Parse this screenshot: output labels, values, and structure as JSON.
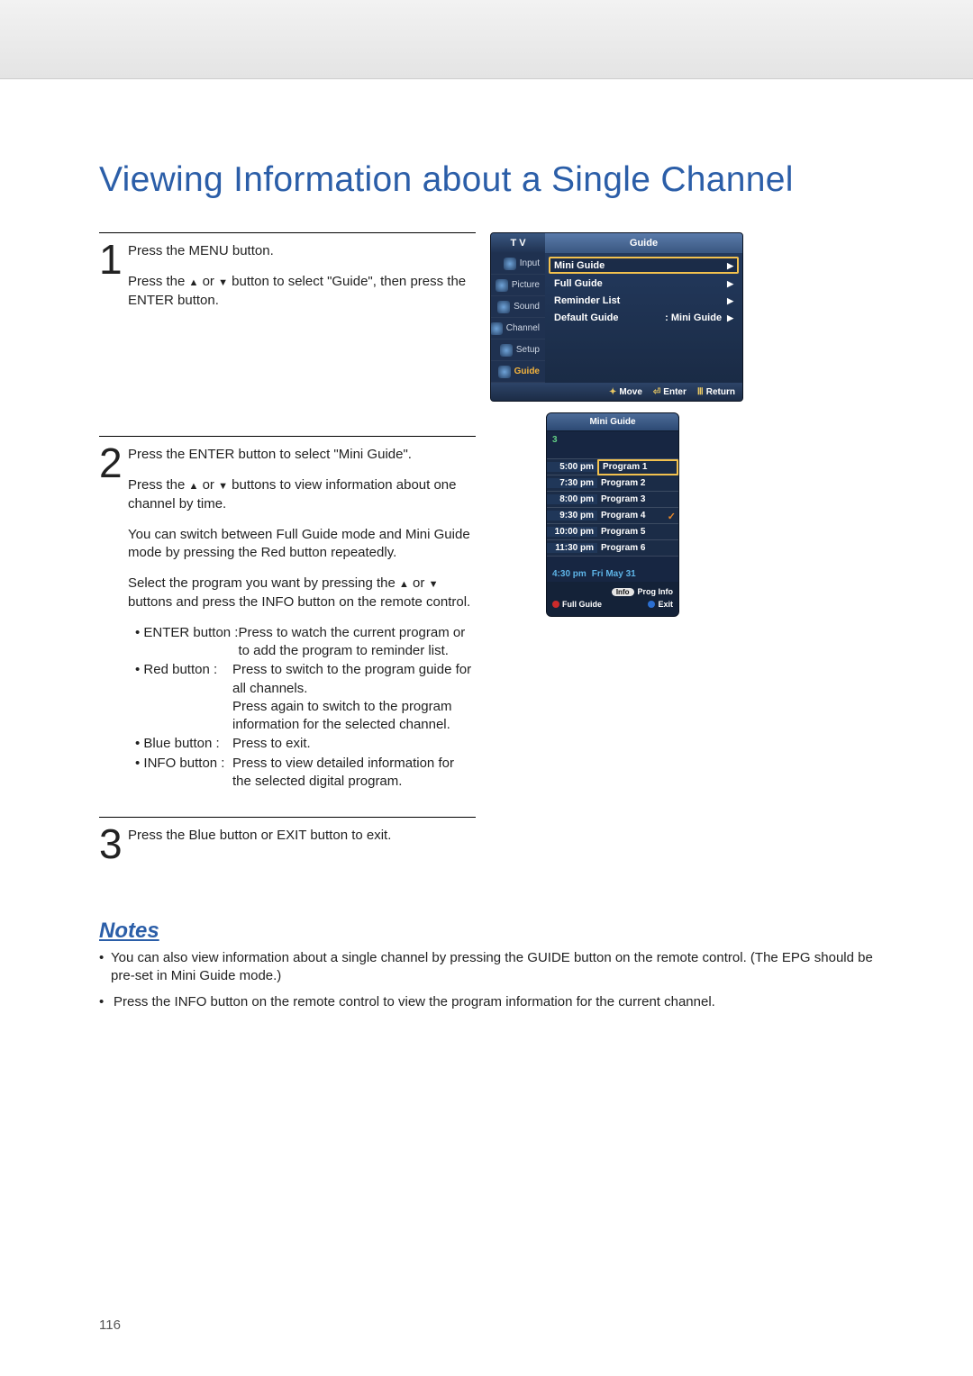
{
  "title": "Viewing Information about a Single Channel",
  "pageNumber": "116",
  "steps": {
    "s1": {
      "num": "1",
      "l1": "Press the MENU button.",
      "l2a": "Press the ",
      "l2b": " or ",
      "l2c": " button to select \"Guide\", then press the ENTER button."
    },
    "s2": {
      "num": "2",
      "p1": "Press the ENTER button to select \"Mini Guide\".",
      "p2a": "Press the ",
      "p2b": " or ",
      "p2c": " buttons to view information about one channel by time.",
      "p3": "You can switch between Full Guide mode and Mini Guide mode by pressing the Red button repeatedly.",
      "p4a": "Select the program you want by pressing the ",
      "p4b": " or ",
      "p4c": " buttons and press the INFO button on the remote control.",
      "b1_label": "ENTER button :",
      "b1_text": "Press to watch the current program or to add the program to reminder list.",
      "b2_label": "Red button :",
      "b2_text": "Press to switch to the program guide for all channels.\nPress again to switch to the program information for the selected channel.",
      "b3_label": "Blue button :",
      "b3_text": "Press to exit.",
      "b4_label": "INFO button :",
      "b4_text": "Press to view detailed information for the selected digital program."
    },
    "s3": {
      "num": "3",
      "p1": "Press the Blue button or EXIT button to exit."
    }
  },
  "notesHeading": "Notes",
  "notes": {
    "n1": "You can also view information about a single channel by pressing the GUIDE button on the remote control. (The EPG should be pre-set in Mini Guide mode.)",
    "n2": "Press the INFO button on the remote control to view the program information for the current channel."
  },
  "osd1": {
    "tv": "T V",
    "headerTitle": "Guide",
    "side": {
      "input": "Input",
      "picture": "Picture",
      "sound": "Sound",
      "channel": "Channel",
      "setup": "Setup",
      "guide": "Guide"
    },
    "rows": {
      "mini": "Mini Guide",
      "full": "Full Guide",
      "reminder": "Reminder List",
      "defaultLabel": "Default Guide",
      "defaultValue": ": Mini Guide"
    },
    "footer": {
      "move": "Move",
      "enter": "Enter",
      "ret": "Return"
    }
  },
  "osd2": {
    "title": "Mini Guide",
    "channel": "3",
    "rows": [
      {
        "t": "5:00 pm",
        "p": "Program 1",
        "sel": true
      },
      {
        "t": "7:30 pm",
        "p": "Program 2"
      },
      {
        "t": "8:00 pm",
        "p": "Program 3"
      },
      {
        "t": "9:30 pm",
        "p": "Program 4",
        "check": true
      },
      {
        "t": "10:00 pm",
        "p": "Program 5"
      },
      {
        "t": "11:30 pm",
        "p": "Program 6"
      }
    ],
    "nowTime": "4:30 pm",
    "nowDate": "Fri May 31",
    "footer": {
      "info": "Info",
      "proginfo": "Prog Info",
      "fullguide": "Full Guide",
      "exit": "Exit"
    }
  }
}
